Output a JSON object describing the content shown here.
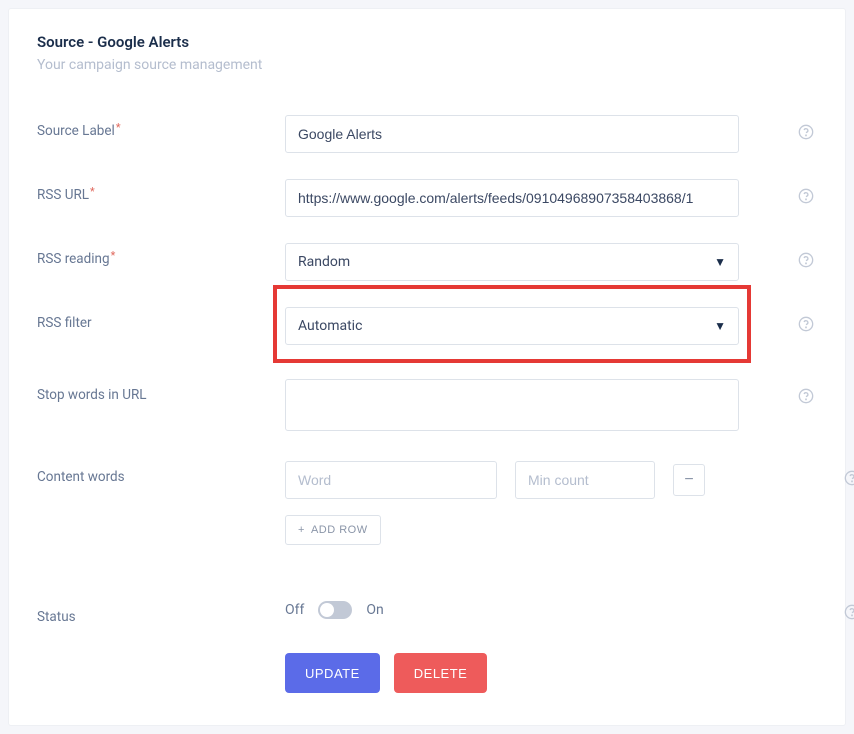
{
  "header": {
    "title": "Source - Google Alerts",
    "subtitle": "Your campaign source management"
  },
  "fields": {
    "source_label": {
      "label": "Source Label",
      "value": "Google Alerts",
      "required": true
    },
    "rss_url": {
      "label": "RSS URL",
      "value": "https://www.google.com/alerts/feeds/09104968907358403868/1",
      "required": true
    },
    "rss_reading": {
      "label": "RSS reading",
      "value": "Random",
      "required": true
    },
    "rss_filter": {
      "label": "RSS filter",
      "value": "Automatic",
      "required": false
    },
    "stop_words": {
      "label": "Stop words in URL",
      "value": ""
    },
    "content_words": {
      "label": "Content words",
      "word_placeholder": "Word",
      "min_count_placeholder": "Min count",
      "add_row_label": "ADD ROW"
    },
    "status": {
      "label": "Status",
      "off_label": "Off",
      "on_label": "On",
      "value": "off"
    }
  },
  "buttons": {
    "update": "UPDATE",
    "delete": "DELETE"
  },
  "required_marker": "*"
}
